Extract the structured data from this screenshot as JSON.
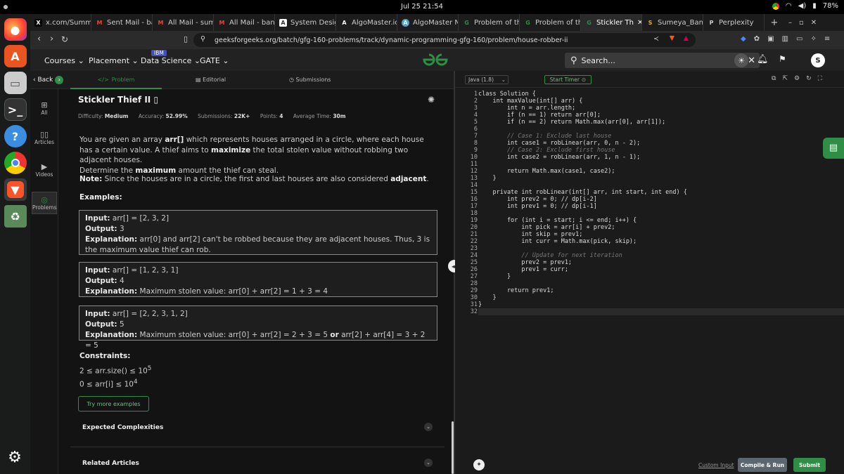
{
  "system": {
    "clock": "Jul 25  21:54",
    "battery": "78%"
  },
  "browser": {
    "tabs": [
      {
        "label": "x.com/Summ",
        "icon": "X"
      },
      {
        "label": "Sent Mail - ba",
        "icon": "M"
      },
      {
        "label": "All Mail - sum",
        "icon": "M"
      },
      {
        "label": "All Mail - banc",
        "icon": "M"
      },
      {
        "label": "System Desig",
        "icon": "A"
      },
      {
        "label": "AlgoMaster.io",
        "icon": "A"
      },
      {
        "label": "AlgoMaster N",
        "icon": "A"
      },
      {
        "label": "Problem of th",
        "icon": "G"
      },
      {
        "label": "Problem of th",
        "icon": "G"
      },
      {
        "label": "Stickler Th",
        "icon": "G"
      },
      {
        "label": "Sumeya_Banc",
        "icon": "S"
      },
      {
        "label": "Perplexity",
        "icon": "P"
      }
    ],
    "url": "geeksforgeeks.org/batch/gfg-160-problems/track/dynamic-programming-gfg-160/problem/house-robber-ii"
  },
  "site": {
    "nav": {
      "courses": "Courses",
      "placement": "Placement",
      "ibm": "IBM",
      "data_science": "Data Science",
      "gate": "GATE"
    },
    "logo": "GfG",
    "search_placeholder": "Search...",
    "avatar": "S"
  },
  "rail": {
    "back": "Back",
    "all": "All",
    "articles": "Articles",
    "videos": "Videos",
    "problems": "Problems"
  },
  "problem_tabs": {
    "problem": "Problem",
    "editorial": "Editorial",
    "submissions": "Submissions"
  },
  "problem": {
    "title": "Stickler Thief II",
    "difficulty_label": "Difficulty:",
    "difficulty": "Medium",
    "accuracy_label": "Accuracy:",
    "accuracy": "52.99%",
    "submissions_label": "Submissions:",
    "submissions": "22K+",
    "points_label": "Points:",
    "points": "4",
    "time_label": "Average Time:",
    "time": "30m",
    "desc_1": "You are given an array ",
    "desc_arr": "arr[]",
    "desc_2": " which represents houses arranged in a circle, where each house has a certain value. A thief aims to ",
    "desc_max": "maximize",
    "desc_3": " the total stolen value without robbing two adjacent houses.",
    "desc_4": "Determine the ",
    "desc_max2": "maximum",
    "desc_5": " amount the thief can steal.",
    "note_label": "Note:",
    "note": " Since the houses are in a circle, the first and last houses are also considered ",
    "note_adj": "adjacent",
    "note_end": ".",
    "examples_heading": "Examples:",
    "examples": [
      {
        "input_label": "Input:",
        "input": " arr[] = [2, 3, 2]",
        "output_label": "Output:",
        "output": " 3",
        "expl_label": "Explanation:",
        "expl": " arr[0] and arr[2] can't be robbed because they are adjacent houses. Thus, 3 is the maximum value thief can rob."
      },
      {
        "input_label": "Input:",
        "input": " arr[] = [1, 2, 3, 1]",
        "output_label": "Output:",
        "output": " 4",
        "expl_label": "Explanation:",
        "expl": " Maximum stolen value: arr[0] + arr[2] = 1 + 3 = 4"
      },
      {
        "input_label": "Input:",
        "input": " arr[] = [2, 2, 3, 1, 2]",
        "output_label": "Output:",
        "output": " 5",
        "expl_label": "Explanation:",
        "expl": " Maximum stolen value: arr[0] + arr[2] = 2 + 3 = 5 ",
        "expl_or": "or",
        "expl_2": " arr[2] + arr[4] = 3 + 2 = 5"
      }
    ],
    "constraints_heading": "Constraints:",
    "constraint_1": "2 ≤ arr.size() ≤ 10",
    "constraint_1_exp": "5",
    "constraint_2": "0 ≤ arr[i] ≤ 10",
    "constraint_2_exp": "4",
    "try_more": "Try more examples",
    "expected_complexities": "Expected Complexities",
    "related_articles": "Related Articles"
  },
  "editor": {
    "language": "Java (1.8)",
    "start_timer": "Start Timer",
    "code_lines": [
      "class Solution {",
      "    int maxValue(int[] arr) {",
      "        int n = arr.length;",
      "        if (n == 1) return arr[0];",
      "        if (n == 2) return Math.max(arr[0], arr[1]);",
      "",
      "        // Case 1: Exclude last house",
      "        int case1 = robLinear(arr, 0, n - 2);",
      "        // Case 2: Exclude first house",
      "        int case2 = robLinear(arr, 1, n - 1);",
      "",
      "        return Math.max(case1, case2);",
      "    }",
      "",
      "    private int robLinear(int[] arr, int start, int end) {",
      "        int prev2 = 0; // dp[i-2]",
      "        int prev1 = 0; // dp[i-1]",
      "",
      "        for (int i = start; i <= end; i++) {",
      "            int pick = arr[i] + prev2;",
      "            int skip = prev1;",
      "            int curr = Math.max(pick, skip);",
      "",
      "            // Update for next iteration",
      "            prev2 = prev1;",
      "            prev1 = curr;",
      "        }",
      "",
      "        return prev1;",
      "    }",
      "}",
      ""
    ],
    "custom_input": "Custom Input",
    "compile_run": "Compile & Run",
    "submit": "Submit"
  },
  "colors": {
    "brand": "#2f8d46",
    "bg": "#131313",
    "panel": "#1b1b1b"
  }
}
